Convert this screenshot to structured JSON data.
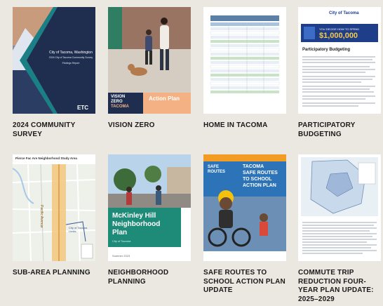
{
  "items": [
    {
      "title": "2024 COMMUNITY SURVEY",
      "cover": {
        "heading1": "City of Tacoma, Washington",
        "heading2": "2024 City of Tacoma Community Survey",
        "heading3": "Findings Report",
        "logo": "ETC"
      }
    },
    {
      "title": "VISION ZERO",
      "cover": {
        "logo_line1": "VISION",
        "logo_line2": "ZERO",
        "logo_line3": "TACOMA",
        "plan_text": "Action Plan"
      }
    },
    {
      "title": "HOME IN TACOMA",
      "cover": {}
    },
    {
      "title": "PARTICIPATORY BUDGETING",
      "cover": {
        "brand": "City of Tacoma",
        "banner_text": "YOU DECIDE HOW TO SPEND",
        "banner_amount": "$1,000,000",
        "heading": "Participatory Budgeting"
      }
    },
    {
      "title": "SUB-AREA PLANNING",
      "cover": {
        "map_title": "Pierce Fac Are Neighborhood Study Area",
        "street": "Pacific Avenue",
        "city_label": "City of Tacoma Limits"
      }
    },
    {
      "title": "NEIGHBORHOOD PLANNING",
      "cover": {
        "title_line1": "McKinley Hill",
        "title_line2": "Neighborhood",
        "title_line3": "Plan",
        "subtitle": "City of Tacoma",
        "footer": "Summer 2023"
      }
    },
    {
      "title": "SAFE ROUTES TO SCHOOL ACTION PLAN UPDATE",
      "cover": {
        "badge_line1": "SAFE",
        "badge_line2": "ROUTES",
        "title_line1": "TACOMA",
        "title_line2": "SAFE ROUTES",
        "title_line3": "TO SCHOOL",
        "title_line4": "ACTION PLAN"
      }
    },
    {
      "title": "COMMUTE TRIP REDUCTION FOUR-YEAR PLAN UPDATE: 2025–2029",
      "cover": {}
    }
  ],
  "colors": {
    "background": "#ebe7e1",
    "label_text": "#1a1a1a",
    "navy": "#1f2d4f",
    "teal": "#1e8a78",
    "peach": "#f4b183",
    "blue": "#2c73b8",
    "orange": "#f39c23"
  }
}
